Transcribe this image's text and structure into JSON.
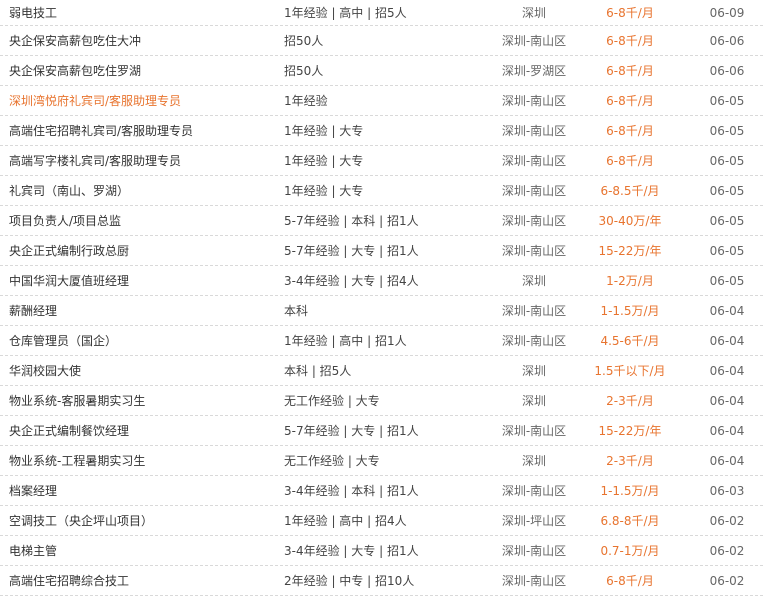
{
  "colors": {
    "accent": "#e8742f",
    "text": "#333333",
    "muted": "#666666",
    "divider": "#d9d9d9"
  },
  "jobs": [
    {
      "title": "弱电技工",
      "req": "1年经验 | 高中 | 招5人",
      "loc": "深圳",
      "salary": "6-8千/月",
      "date": "06-09",
      "highlight": false
    },
    {
      "title": "央企保安高薪包吃住大冲",
      "req": "招50人",
      "loc": "深圳-南山区",
      "salary": "6-8千/月",
      "date": "06-06",
      "highlight": false
    },
    {
      "title": "央企保安高薪包吃住罗湖",
      "req": "招50人",
      "loc": "深圳-罗湖区",
      "salary": "6-8千/月",
      "date": "06-06",
      "highlight": false
    },
    {
      "title": "深圳湾悦府礼宾司/客服助理专员",
      "req": "1年经验",
      "loc": "深圳-南山区",
      "salary": "6-8千/月",
      "date": "06-05",
      "highlight": true
    },
    {
      "title": "高端住宅招聘礼宾司/客服助理专员",
      "req": "1年经验 | 大专",
      "loc": "深圳-南山区",
      "salary": "6-8千/月",
      "date": "06-05",
      "highlight": false
    },
    {
      "title": "高端写字楼礼宾司/客服助理专员",
      "req": "1年经验 | 大专",
      "loc": "深圳-南山区",
      "salary": "6-8千/月",
      "date": "06-05",
      "highlight": false
    },
    {
      "title": "礼宾司（南山、罗湖）",
      "req": "1年经验 | 大专",
      "loc": "深圳-南山区",
      "salary": "6-8.5千/月",
      "date": "06-05",
      "highlight": false
    },
    {
      "title": "项目负责人/项目总监",
      "req": "5-7年经验 | 本科 | 招1人",
      "loc": "深圳-南山区",
      "salary": "30-40万/年",
      "date": "06-05",
      "highlight": false
    },
    {
      "title": "央企正式编制行政总厨",
      "req": "5-7年经验 | 大专 | 招1人",
      "loc": "深圳-南山区",
      "salary": "15-22万/年",
      "date": "06-05",
      "highlight": false
    },
    {
      "title": "中国华润大厦值班经理",
      "req": "3-4年经验 | 大专 | 招4人",
      "loc": "深圳",
      "salary": "1-2万/月",
      "date": "06-05",
      "highlight": false
    },
    {
      "title": "薪酬经理",
      "req": "本科",
      "loc": "深圳-南山区",
      "salary": "1-1.5万/月",
      "date": "06-04",
      "highlight": false
    },
    {
      "title": "仓库管理员（国企）",
      "req": "1年经验 | 高中 | 招1人",
      "loc": "深圳-南山区",
      "salary": "4.5-6千/月",
      "date": "06-04",
      "highlight": false
    },
    {
      "title": "华润校园大使",
      "req": "本科 | 招5人",
      "loc": "深圳",
      "salary": "1.5千以下/月",
      "date": "06-04",
      "highlight": false
    },
    {
      "title": "物业系统-客服暑期实习生",
      "req": "无工作经验 | 大专",
      "loc": "深圳",
      "salary": "2-3千/月",
      "date": "06-04",
      "highlight": false
    },
    {
      "title": "央企正式编制餐饮经理",
      "req": "5-7年经验 | 大专 | 招1人",
      "loc": "深圳-南山区",
      "salary": "15-22万/年",
      "date": "06-04",
      "highlight": false
    },
    {
      "title": "物业系统-工程暑期实习生",
      "req": "无工作经验 | 大专",
      "loc": "深圳",
      "salary": "2-3千/月",
      "date": "06-04",
      "highlight": false
    },
    {
      "title": "档案经理",
      "req": "3-4年经验 | 本科 | 招1人",
      "loc": "深圳-南山区",
      "salary": "1-1.5万/月",
      "date": "06-03",
      "highlight": false
    },
    {
      "title": "空调技工（央企坪山项目）",
      "req": "1年经验 | 高中 | 招4人",
      "loc": "深圳-坪山区",
      "salary": "6.8-8千/月",
      "date": "06-02",
      "highlight": false
    },
    {
      "title": "电梯主管",
      "req": "3-4年经验 | 大专 | 招1人",
      "loc": "深圳-南山区",
      "salary": "0.7-1万/月",
      "date": "06-02",
      "highlight": false
    },
    {
      "title": "高端住宅招聘综合技工",
      "req": "2年经验 | 中专 | 招10人",
      "loc": "深圳-南山区",
      "salary": "6-8千/月",
      "date": "06-02",
      "highlight": false
    }
  ]
}
